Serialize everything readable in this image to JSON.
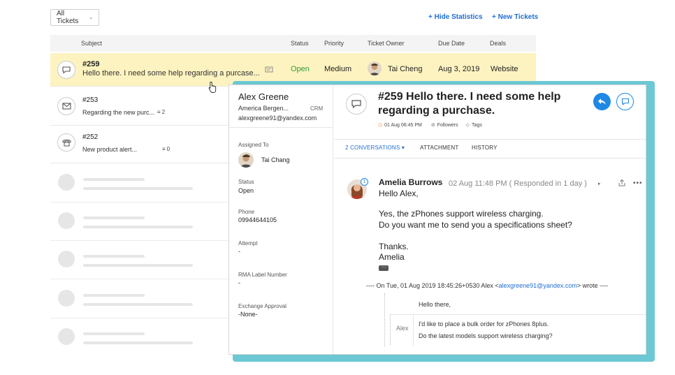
{
  "toolbar": {
    "filter_label": "All Tickets",
    "hide_statistics": "+ Hide Statistics",
    "new_tickets": "+ New Tickets"
  },
  "table": {
    "headers": [
      "Subject",
      "Status",
      "Priority",
      "Ticket Owner",
      "Due Date",
      "Deals"
    ],
    "rows": [
      {
        "number": "#259",
        "subject": "Hello there. I need some help regarding a purcase...",
        "status": "Open",
        "priority": "Medium",
        "owner": "Tai Cheng",
        "due_date": "Aug 3, 2019",
        "deal": "Website",
        "icon": "chat-bubble-icon"
      },
      {
        "number": "#253",
        "subject": "Regarding the new purc...",
        "thread_count": "2",
        "icon": "envelope-icon"
      },
      {
        "number": "#252",
        "subject": "New product alert...",
        "thread_count": "0",
        "icon": "phone-icon"
      }
    ]
  },
  "contact": {
    "name": "Alex Greene",
    "company": "America Bergen...",
    "company_tag": "CRM",
    "email": "alexgreene91@yandex.com"
  },
  "fields": [
    {
      "label": "Assigned To",
      "value": "Tai Chang"
    },
    {
      "label": "Status",
      "value": "Open"
    },
    {
      "label": "Phone",
      "value": "09944644105"
    },
    {
      "label": "Attempt",
      "value": "-"
    },
    {
      "label": "RMA Label Number",
      "value": "-"
    },
    {
      "label": "Exchange Approval",
      "value": "-None-"
    }
  ],
  "ticket": {
    "title_line1": "#259 Hello there. I need some help",
    "title_line2": "regarding a purchase.",
    "date": "01 Aug 06:45 PM",
    "followers": "Followers",
    "tags": "Tags"
  },
  "tabs": {
    "conversations": "2 CONVERSATIONS",
    "attachment": "ATTACHMENT",
    "history": "HISTORY"
  },
  "message": {
    "author": "Amelia Burrows",
    "meta": "02 Aug 11:48 PM ( Responded in 1 day )",
    "badge": "1",
    "lines": [
      "Hello Alex,",
      "Yes, the zPhones support wireless charging.",
      "Do you want me to send you a specifications sheet?",
      "Thanks.",
      "Amelia"
    ],
    "quote_prefix": "---- On Tue, 01 Aug 2019 18:45:26+0530 Alex <",
    "quote_email": "alexgreene91@yandex.com",
    "quote_suffix": "> wrote ----",
    "quote_greeting": "Hello there,",
    "quote_sender": "Alex",
    "quote_line1": "I'd like to place a bulk order for zPhones 8plus.",
    "quote_line2": "Do the latest models support wireless charging?"
  },
  "colors": {
    "accent": "#1f6ed4",
    "selected_row": "#fdf3c0",
    "status_open": "#2e9c3a",
    "card_shadow": "#6bc8d4"
  }
}
